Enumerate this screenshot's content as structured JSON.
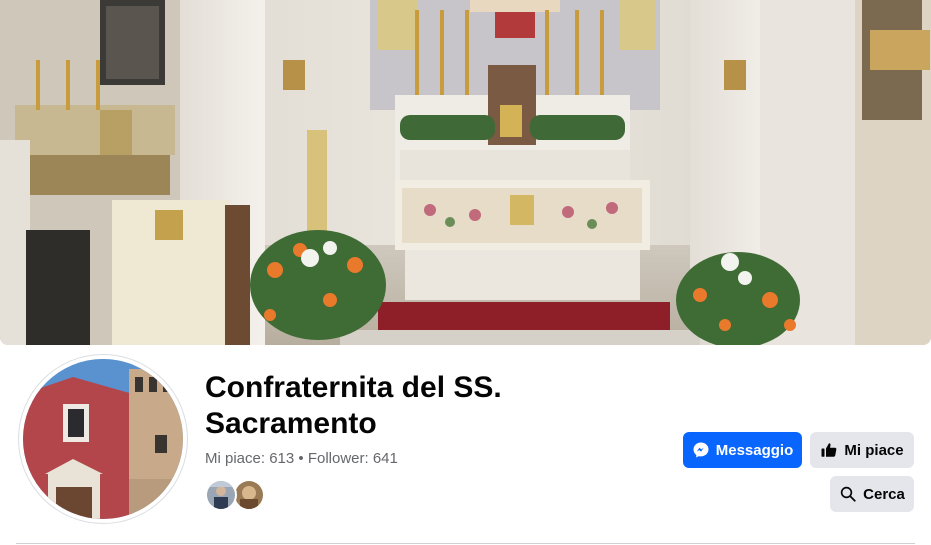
{
  "page": {
    "name": "Confraternita del SS. Sacramento",
    "stats": {
      "likes_label": "Mi piace: 613",
      "separator": " • ",
      "followers_label": "Follower: 641"
    }
  },
  "actions": {
    "message_label": "Messaggio",
    "like_label": "Mi piace",
    "search_label": "Cerca"
  },
  "icons": {
    "message": "messenger-icon",
    "like": "thumbs-up-icon",
    "search": "search-icon"
  },
  "colors": {
    "primary_button": "#0866ff",
    "secondary_button": "#e4e6eb",
    "secondary_text": "#65676b",
    "text": "#050505"
  }
}
